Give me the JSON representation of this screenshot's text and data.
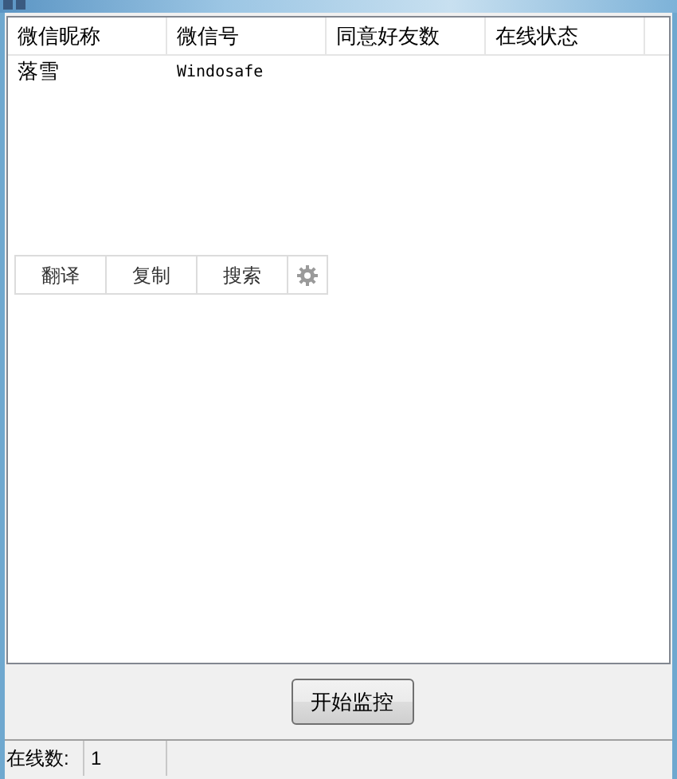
{
  "table": {
    "columns": [
      "微信昵称",
      "微信号",
      "同意好友数",
      "在线状态"
    ],
    "rows": [
      {
        "cells": [
          "落雪",
          "Windosafe",
          "",
          ""
        ]
      }
    ]
  },
  "toolbar": {
    "buttons": [
      {
        "kind": "text",
        "label": "翻译"
      },
      {
        "kind": "text",
        "label": "复制"
      },
      {
        "kind": "text",
        "label": "搜索"
      },
      {
        "kind": "gear"
      }
    ]
  },
  "start_button": "开始监控",
  "status_bar": {
    "label": "在线数:",
    "value": "1"
  }
}
